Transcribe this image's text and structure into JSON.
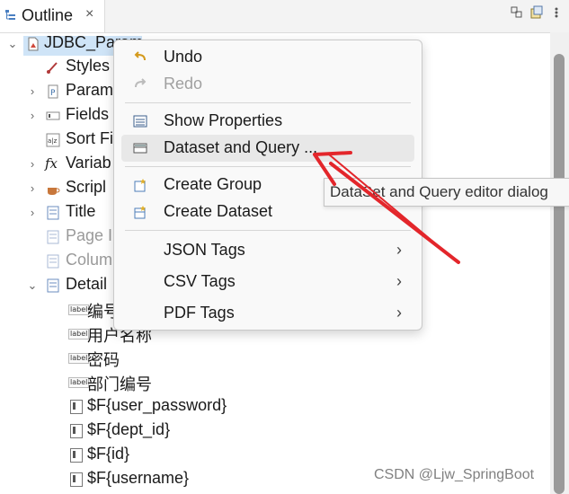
{
  "view": {
    "title": "Outline",
    "close_glyph": "×",
    "tools": [
      "collapse-icon",
      "link-editor-icon",
      "view-menu-icon"
    ]
  },
  "tree": {
    "root": "JDBC_Param",
    "items": [
      {
        "label": "Styles",
        "icon": "brush-icon"
      },
      {
        "label": "Param",
        "icon": "parameters-icon"
      },
      {
        "label": "Fields",
        "icon": "fields-icon"
      },
      {
        "label": "Sort Fi",
        "icon": "sort-icon"
      },
      {
        "label": "Variab",
        "icon": "variables-icon"
      },
      {
        "label": "Scripl",
        "icon": "scriptlet-icon"
      },
      {
        "label": "Title",
        "icon": "band-icon"
      },
      {
        "label": "Page I",
        "icon": "band-icon"
      },
      {
        "label": "Colum",
        "icon": "band-icon"
      },
      {
        "label": "Detail",
        "icon": "band-icon"
      }
    ],
    "detail_children": [
      {
        "label": "编号",
        "icon": "label-icon"
      },
      {
        "label": "用户名称",
        "icon": "label-icon"
      },
      {
        "label": "密码",
        "icon": "label-icon"
      },
      {
        "label": "部门编号",
        "icon": "label-icon"
      },
      {
        "label": "$F{user_password}",
        "icon": "text-field-icon"
      },
      {
        "label": "$F{dept_id}",
        "icon": "text-field-icon"
      },
      {
        "label": "$F{id}",
        "icon": "text-field-icon"
      },
      {
        "label": "$F{username}",
        "icon": "text-field-icon"
      }
    ],
    "label_icon_text": "label"
  },
  "menu": {
    "items": [
      {
        "label": "Undo",
        "icon": "undo-icon"
      },
      {
        "label": "Redo",
        "icon": "redo-icon",
        "disabled": true
      },
      {
        "label": "Show Properties",
        "icon": "properties-icon"
      },
      {
        "label": "Dataset and Query ...",
        "icon": "dataset-icon"
      },
      {
        "label": "Create Group",
        "icon": "create-group-icon"
      },
      {
        "label": "Create Dataset",
        "icon": "create-dataset-icon"
      },
      {
        "label": "JSON Tags",
        "submenu": true
      },
      {
        "label": "CSV Tags",
        "submenu": true
      },
      {
        "label": "PDF Tags",
        "submenu": true
      }
    ],
    "submenu_glyph": "›"
  },
  "tooltip": "DataSet and Query editor dialog",
  "watermark": "CSDN @Ljw_SpringBoot",
  "colors": {
    "selection": "#cfe4f7",
    "annotation_arrow": "#e3262b",
    "menu_hover": "#e8e8e8"
  }
}
